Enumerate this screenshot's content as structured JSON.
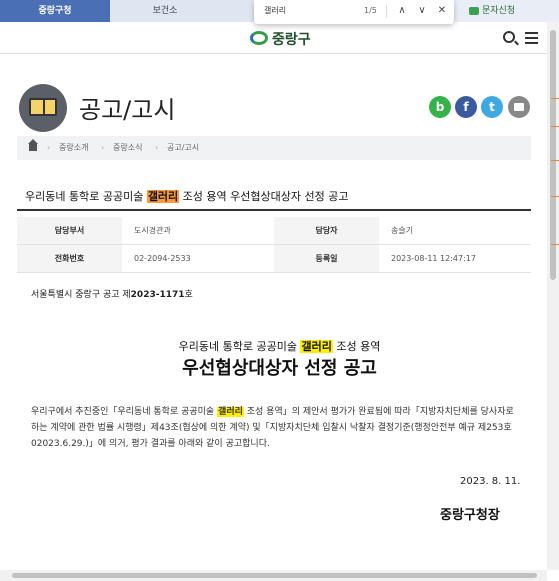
{
  "tabs": {
    "active_label": "중랑구청",
    "second_label": "보건소"
  },
  "civil_label": "문자신청",
  "findbar": {
    "query": "갤러리",
    "count": "1/5",
    "prev": "∧",
    "next": "∨",
    "close": "✕"
  },
  "header": {
    "logo_text": "중랑구"
  },
  "page": {
    "title": "공고/고시"
  },
  "share": {
    "blog": "b",
    "facebook": "f",
    "twitter": "t"
  },
  "breadcrumb": [
    "중랑소개",
    "중랑소식",
    "공고/고시"
  ],
  "post": {
    "title_before": "우리동네 통학로 공공미술 ",
    "title_highlight": "갤러리",
    "title_after": " 조성 용역 우선협상대상자 선정 공고"
  },
  "info": {
    "dept_label": "담당부서",
    "dept_value": "도시경관과",
    "manager_label": "담당자",
    "manager_value": "송슬기",
    "phone_label": "전화번호",
    "phone_value": "02-2094-2533",
    "date_label": "등록일",
    "date_value": "2023-08-11 12:47:17"
  },
  "notice": {
    "prefix": "서울특별시 중랑구 공고 제",
    "number": "2023-1171",
    "suffix": "호"
  },
  "document": {
    "subtitle_before": "우리동네 통학로 공공미술 ",
    "subtitle_highlight": "갤러리",
    "subtitle_after": " 조성 용역",
    "title": "우선협상대상자 선정 공고",
    "body_before": "우리구에서 추진중인「우리동네 통학로 공공미술 ",
    "body_highlight": "갤러리",
    "body_after": " 조성 용역」의 제안서 평가가 완료됨에 따라「지방자치단체를 당사자로 하는 계약에 관한 법률 시행령」제43조(협상에 의한 계약) 및「지방자치단체 입찰시 낙찰자 결정기준(행정안전부 예규 제253호02023.6.29.)」에 의거, 평가 결과를 아래와 같이 공고합니다.",
    "date": "2023. 8. 11.",
    "signature": "중랑구청장"
  }
}
